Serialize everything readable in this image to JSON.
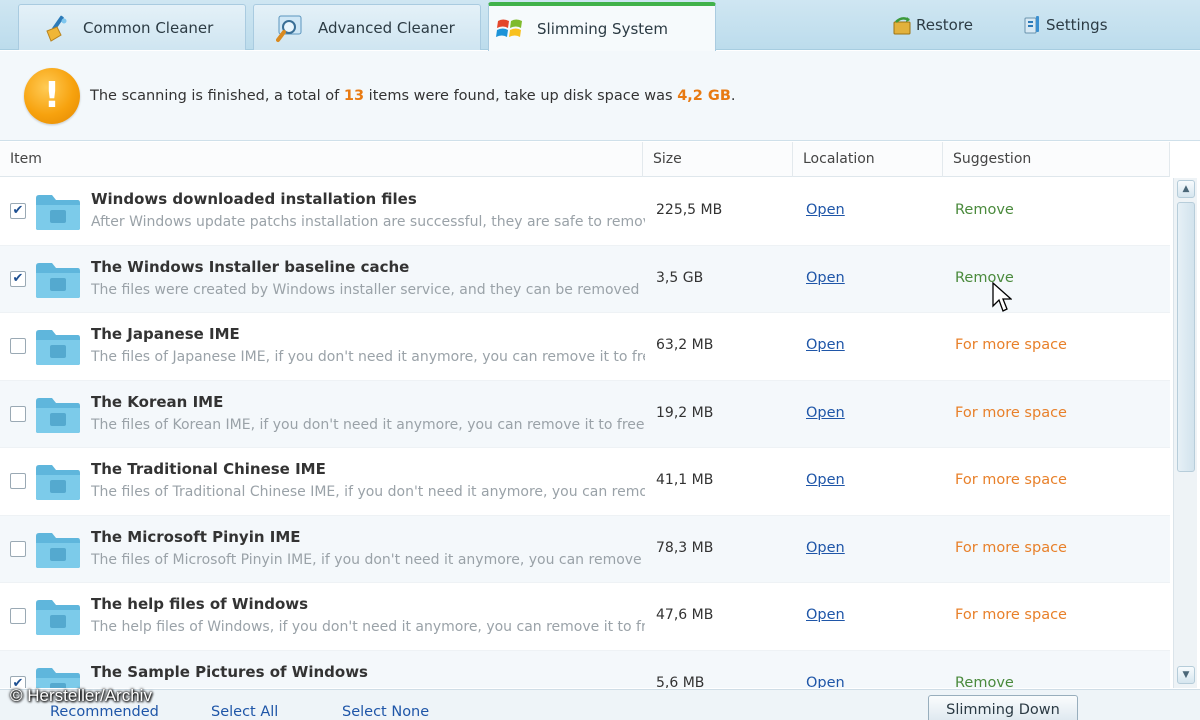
{
  "tabs": [
    {
      "label": "Common Cleaner",
      "icon": "broom-icon",
      "active": false
    },
    {
      "label": "Advanced Cleaner",
      "icon": "magnifier-icon",
      "active": false
    },
    {
      "label": "Slimming System",
      "icon": "windows-logo-icon",
      "active": true
    }
  ],
  "top_links": {
    "restore": {
      "label": "Restore",
      "icon": "restore-icon"
    },
    "settings": {
      "label": "Settings",
      "icon": "settings-icon"
    }
  },
  "banner": {
    "text_before": "The scanning is finished, a total of ",
    "count": "13",
    "text_middle": " items were found, take up disk space was ",
    "size": "4,2 GB",
    "text_after": "."
  },
  "columns": {
    "item": "Item",
    "size": "Size",
    "location": "Localation",
    "suggestion": "Suggestion"
  },
  "rows": [
    {
      "checked": true,
      "title": "Windows downloaded installation files",
      "desc": "After Windows update patchs installation are successful, they are safe to remove",
      "size": "225,5 MB",
      "open": "Open",
      "suggestion": "Remove",
      "kind": "remove"
    },
    {
      "checked": true,
      "title": "The Windows Installer baseline cache",
      "desc": "The files were created by Windows installer service, and they can be removed",
      "size": "3,5 GB",
      "open": "Open",
      "suggestion": "Remove",
      "kind": "remove"
    },
    {
      "checked": false,
      "title": "The Japanese IME",
      "desc": "The files of Japanese IME, if you don't need it anymore, you can remove it to free",
      "size": "63,2 MB",
      "open": "Open",
      "suggestion": "For more space",
      "kind": "space"
    },
    {
      "checked": false,
      "title": "The Korean IME",
      "desc": "The files of Korean IME, if you don't need it anymore, you can remove it to free",
      "size": "19,2 MB",
      "open": "Open",
      "suggestion": "For more space",
      "kind": "space"
    },
    {
      "checked": false,
      "title": "The Traditional Chinese IME",
      "desc": "The files of Traditional Chinese IME, if you don't need it anymore, you can remove",
      "size": "41,1 MB",
      "open": "Open",
      "suggestion": "For more space",
      "kind": "space"
    },
    {
      "checked": false,
      "title": "The Microsoft Pinyin IME",
      "desc": "The files of Microsoft Pinyin IME, if you don't need it anymore, you can remove",
      "size": "78,3 MB",
      "open": "Open",
      "suggestion": "For more space",
      "kind": "space"
    },
    {
      "checked": false,
      "title": "The help files of Windows",
      "desc": "The help files of Windows, if you don't need it anymore, you can remove it to free",
      "size": "47,6 MB",
      "open": "Open",
      "suggestion": "For more space",
      "kind": "space"
    },
    {
      "checked": true,
      "title": "The Sample Pictures of Windows",
      "desc": "",
      "size": "5,6 MB",
      "open": "Open",
      "suggestion": "Remove",
      "kind": "remove"
    }
  ],
  "footer": {
    "recommended": "Recommended",
    "select_all": "Select All",
    "select_none": "Select None",
    "slim_button": "Slimming Down"
  },
  "watermark": "© Hersteller/Archiv"
}
